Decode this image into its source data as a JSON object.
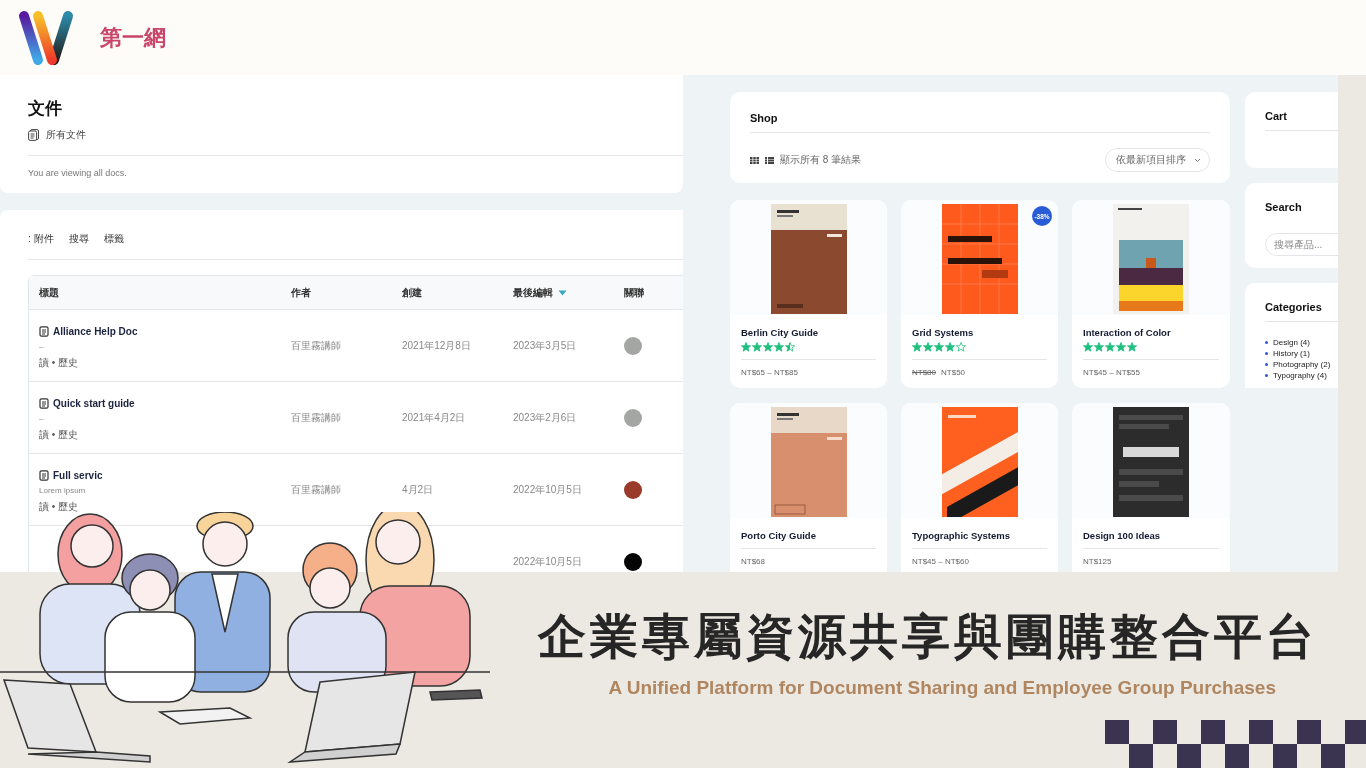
{
  "brand": {
    "name": "第一網"
  },
  "docs": {
    "title": "文件",
    "breadcrumb": "所有文件",
    "notice": "You are viewing all docs.",
    "tabs": [
      {
        "label": ": 附件"
      },
      {
        "label": "搜尋"
      },
      {
        "label": "標籤"
      }
    ],
    "columns": [
      {
        "label": "標題",
        "sorted": false
      },
      {
        "label": "作者",
        "sorted": false
      },
      {
        "label": "創建",
        "sorted": false
      },
      {
        "label": "最後編輯",
        "sorted": true
      },
      {
        "label": "關聯",
        "sorted": false
      }
    ],
    "rows": [
      {
        "title": "Alliance Help Doc",
        "excerpt": "–",
        "actions": "讀 • 歷史",
        "author": "百里霧講師",
        "created": "2021年12月8日",
        "edited": "2023年3月5日",
        "color": "#a4a6a3"
      },
      {
        "title": "Quick start guide",
        "excerpt": "–",
        "actions": "讀 • 歷史",
        "author": "百里霧講師",
        "created": "2021年4月2日",
        "edited": "2023年2月6日",
        "color": "#a4a6a3"
      },
      {
        "title": "Full servic",
        "excerpt": "Lorem ipsum",
        "actions": "讀 • 歷史",
        "author": "百里霧講師",
        "created": "4月2日",
        "edited": "2022年10月5日",
        "color": "#9b3a2a"
      },
      {
        "edited": "2022年10月5日",
        "color": "#050505"
      }
    ]
  },
  "shop": {
    "title": "Shop",
    "result_count": "顯示所有 8 筆結果",
    "sort": "依最新項目排序",
    "products": [
      {
        "kind": "picture",
        "name": "Berlin City Guide",
        "stars": 4.5,
        "price": "NT$65 – NT$85"
      },
      {
        "kind": "picture",
        "name": "Grid Systems",
        "badge": "-38%",
        "stars": 4,
        "old_price": "NT$80",
        "price": "NT$50"
      },
      {
        "kind": "picture",
        "name": "Interaction of Color",
        "stars": 5,
        "price": "NT$45 – NT$55"
      },
      {
        "kind": "picture",
        "name": "Porto City Guide",
        "price": "NT$68"
      },
      {
        "kind": "picture",
        "name": "Typographic Systems",
        "price": "NT$45 – NT$60"
      },
      {
        "kind": "picture",
        "name": "Design 100 Ideas",
        "price": "NT$125"
      }
    ]
  },
  "sidebar": {
    "cart": {
      "title": "Cart"
    },
    "search": {
      "title": "Search",
      "placeholder": "搜尋產品..."
    },
    "categories": {
      "title": "Categories",
      "items": [
        "Design (4)",
        "History (1)",
        "Photography (2)",
        "Typography (4)"
      ]
    }
  },
  "footer": {
    "headline": "企業專屬資源共享與團購整合平台",
    "subtitle": "A Unified Platform for Document Sharing and Employee Group Purchases"
  }
}
